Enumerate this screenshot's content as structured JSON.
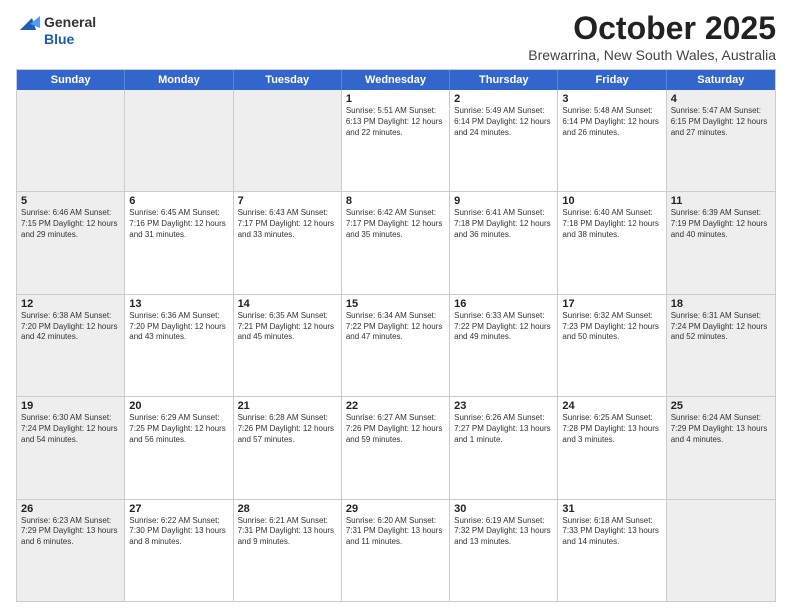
{
  "header": {
    "logo_general": "General",
    "logo_blue": "Blue",
    "month": "October 2025",
    "location": "Brewarrina, New South Wales, Australia"
  },
  "weekdays": [
    "Sunday",
    "Monday",
    "Tuesday",
    "Wednesday",
    "Thursday",
    "Friday",
    "Saturday"
  ],
  "rows": [
    [
      {
        "day": "",
        "info": "",
        "shaded": true
      },
      {
        "day": "",
        "info": "",
        "shaded": true
      },
      {
        "day": "",
        "info": "",
        "shaded": true
      },
      {
        "day": "1",
        "info": "Sunrise: 5:51 AM\nSunset: 6:13 PM\nDaylight: 12 hours\nand 22 minutes.",
        "shaded": false
      },
      {
        "day": "2",
        "info": "Sunrise: 5:49 AM\nSunset: 6:14 PM\nDaylight: 12 hours\nand 24 minutes.",
        "shaded": false
      },
      {
        "day": "3",
        "info": "Sunrise: 5:48 AM\nSunset: 6:14 PM\nDaylight: 12 hours\nand 26 minutes.",
        "shaded": false
      },
      {
        "day": "4",
        "info": "Sunrise: 5:47 AM\nSunset: 6:15 PM\nDaylight: 12 hours\nand 27 minutes.",
        "shaded": true
      }
    ],
    [
      {
        "day": "5",
        "info": "Sunrise: 6:46 AM\nSunset: 7:15 PM\nDaylight: 12 hours\nand 29 minutes.",
        "shaded": true
      },
      {
        "day": "6",
        "info": "Sunrise: 6:45 AM\nSunset: 7:16 PM\nDaylight: 12 hours\nand 31 minutes.",
        "shaded": false
      },
      {
        "day": "7",
        "info": "Sunrise: 6:43 AM\nSunset: 7:17 PM\nDaylight: 12 hours\nand 33 minutes.",
        "shaded": false
      },
      {
        "day": "8",
        "info": "Sunrise: 6:42 AM\nSunset: 7:17 PM\nDaylight: 12 hours\nand 35 minutes.",
        "shaded": false
      },
      {
        "day": "9",
        "info": "Sunrise: 6:41 AM\nSunset: 7:18 PM\nDaylight: 12 hours\nand 36 minutes.",
        "shaded": false
      },
      {
        "day": "10",
        "info": "Sunrise: 6:40 AM\nSunset: 7:18 PM\nDaylight: 12 hours\nand 38 minutes.",
        "shaded": false
      },
      {
        "day": "11",
        "info": "Sunrise: 6:39 AM\nSunset: 7:19 PM\nDaylight: 12 hours\nand 40 minutes.",
        "shaded": true
      }
    ],
    [
      {
        "day": "12",
        "info": "Sunrise: 6:38 AM\nSunset: 7:20 PM\nDaylight: 12 hours\nand 42 minutes.",
        "shaded": true
      },
      {
        "day": "13",
        "info": "Sunrise: 6:36 AM\nSunset: 7:20 PM\nDaylight: 12 hours\nand 43 minutes.",
        "shaded": false
      },
      {
        "day": "14",
        "info": "Sunrise: 6:35 AM\nSunset: 7:21 PM\nDaylight: 12 hours\nand 45 minutes.",
        "shaded": false
      },
      {
        "day": "15",
        "info": "Sunrise: 6:34 AM\nSunset: 7:22 PM\nDaylight: 12 hours\nand 47 minutes.",
        "shaded": false
      },
      {
        "day": "16",
        "info": "Sunrise: 6:33 AM\nSunset: 7:22 PM\nDaylight: 12 hours\nand 49 minutes.",
        "shaded": false
      },
      {
        "day": "17",
        "info": "Sunrise: 6:32 AM\nSunset: 7:23 PM\nDaylight: 12 hours\nand 50 minutes.",
        "shaded": false
      },
      {
        "day": "18",
        "info": "Sunrise: 6:31 AM\nSunset: 7:24 PM\nDaylight: 12 hours\nand 52 minutes.",
        "shaded": true
      }
    ],
    [
      {
        "day": "19",
        "info": "Sunrise: 6:30 AM\nSunset: 7:24 PM\nDaylight: 12 hours\nand 54 minutes.",
        "shaded": true
      },
      {
        "day": "20",
        "info": "Sunrise: 6:29 AM\nSunset: 7:25 PM\nDaylight: 12 hours\nand 56 minutes.",
        "shaded": false
      },
      {
        "day": "21",
        "info": "Sunrise: 6:28 AM\nSunset: 7:26 PM\nDaylight: 12 hours\nand 57 minutes.",
        "shaded": false
      },
      {
        "day": "22",
        "info": "Sunrise: 6:27 AM\nSunset: 7:26 PM\nDaylight: 12 hours\nand 59 minutes.",
        "shaded": false
      },
      {
        "day": "23",
        "info": "Sunrise: 6:26 AM\nSunset: 7:27 PM\nDaylight: 13 hours\nand 1 minute.",
        "shaded": false
      },
      {
        "day": "24",
        "info": "Sunrise: 6:25 AM\nSunset: 7:28 PM\nDaylight: 13 hours\nand 3 minutes.",
        "shaded": false
      },
      {
        "day": "25",
        "info": "Sunrise: 6:24 AM\nSunset: 7:29 PM\nDaylight: 13 hours\nand 4 minutes.",
        "shaded": true
      }
    ],
    [
      {
        "day": "26",
        "info": "Sunrise: 6:23 AM\nSunset: 7:29 PM\nDaylight: 13 hours\nand 6 minutes.",
        "shaded": true
      },
      {
        "day": "27",
        "info": "Sunrise: 6:22 AM\nSunset: 7:30 PM\nDaylight: 13 hours\nand 8 minutes.",
        "shaded": false
      },
      {
        "day": "28",
        "info": "Sunrise: 6:21 AM\nSunset: 7:31 PM\nDaylight: 13 hours\nand 9 minutes.",
        "shaded": false
      },
      {
        "day": "29",
        "info": "Sunrise: 6:20 AM\nSunset: 7:31 PM\nDaylight: 13 hours\nand 11 minutes.",
        "shaded": false
      },
      {
        "day": "30",
        "info": "Sunrise: 6:19 AM\nSunset: 7:32 PM\nDaylight: 13 hours\nand 13 minutes.",
        "shaded": false
      },
      {
        "day": "31",
        "info": "Sunrise: 6:18 AM\nSunset: 7:33 PM\nDaylight: 13 hours\nand 14 minutes.",
        "shaded": false
      },
      {
        "day": "",
        "info": "",
        "shaded": true
      }
    ]
  ]
}
